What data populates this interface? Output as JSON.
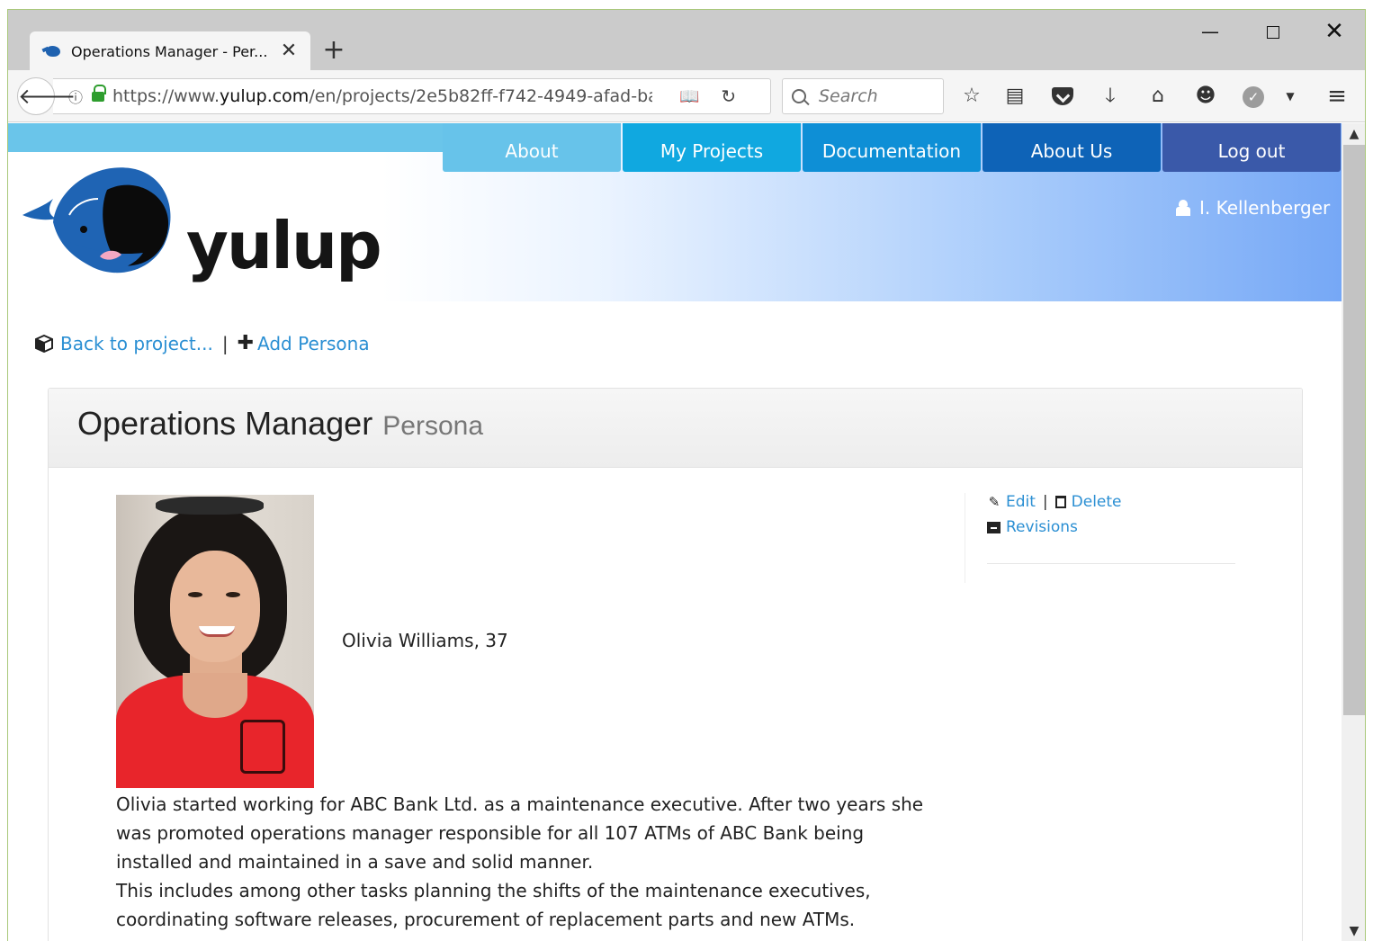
{
  "browser": {
    "tab_title": "Operations Manager - Per...",
    "url_prefix": "https://www.",
    "url_domain": "yulup.com",
    "url_path": "/en/projects/2e5b82ff-f742-4949-afad-ba4",
    "search_placeholder": "Search"
  },
  "site": {
    "logo_text": "yulup",
    "menu": [
      "About",
      "My Projects",
      "Documentation",
      "About Us",
      "Log out"
    ],
    "user_name": "I. Kellenberger",
    "colors": {
      "link": "#2b8fd3",
      "menu_about": "#67c3ea",
      "menu_projects": "#10a8e0",
      "menu_docs": "#0e8fd6",
      "menu_aboutus": "#0e63b7",
      "menu_logout": "#3a59a9"
    }
  },
  "breadcrumb": {
    "back_label": "Back to project...",
    "separator": "|",
    "add_label": "Add Persona"
  },
  "panel": {
    "title": "Operations Manager",
    "subtitle": "Persona"
  },
  "persona": {
    "name_age": "Olivia Williams, 37",
    "bio": [
      "Olivia started working for ABC Bank Ltd. as a maintenance executive. After two years she was promoted operations manager responsible for all 107 ATMs of ABC Bank being installed and maintained in a save and solid manner.",
      "This includes among other tasks planning the shifts of the maintenance executives, coordinating software releases, procurement of replacement parts and new ATMs."
    ]
  },
  "actions": {
    "edit_label": "Edit",
    "separator": "|",
    "delete_label": "Delete",
    "revisions_label": "Revisions"
  }
}
